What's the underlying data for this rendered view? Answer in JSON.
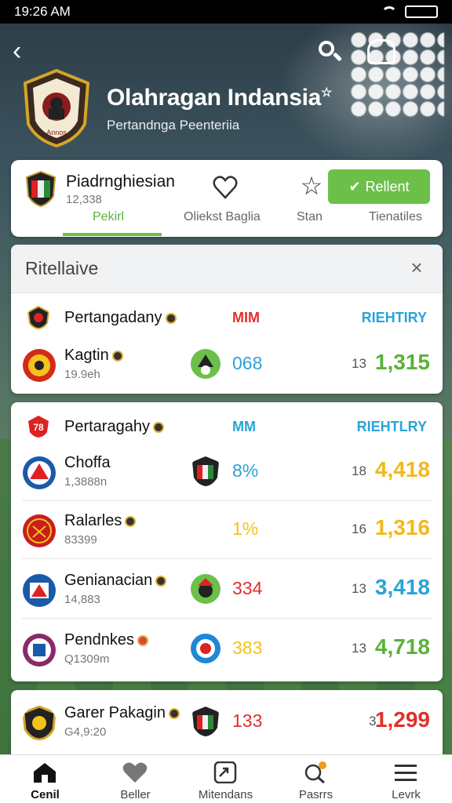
{
  "status_bar": {
    "time": "19:26 AM"
  },
  "header": {
    "title": "Olahragan Indansia",
    "subtitle": "Pertandnga Peenteriia",
    "crest_text": "Annos"
  },
  "team_card": {
    "name": "Piadrnghiesian",
    "count": "12,338",
    "follow_label": "Rellent",
    "tabs": [
      {
        "label": "Pekirl",
        "active": true
      },
      {
        "label": "Oliekst Baglia",
        "active": false
      },
      {
        "label": "Stan",
        "active": false
      },
      {
        "label": "Tienatiles",
        "active": false
      }
    ]
  },
  "panel": {
    "title": "Ritellaive",
    "close_label": "×"
  },
  "sections": [
    {
      "name": "Pertangadany",
      "col_mid": "MIM",
      "col_right": "RIEHTIRY",
      "mid_color": "#e0302a",
      "right_color": "#2aa3d6",
      "rows": [
        {
          "name": "Kagtin",
          "sub": "19.9eh",
          "pct": "068",
          "pct_color": "#2aa3d6",
          "small": "13",
          "score": "1,315",
          "score_color": "#5bb13a"
        }
      ]
    },
    {
      "name": "Pertaragahy",
      "icon_label": "78",
      "col_mid": "MM",
      "col_right": "RIEHTLRY",
      "mid_color": "#2aa3d6",
      "right_color": "#2aa3d6",
      "rows": [
        {
          "name": "Choffa",
          "sub": "1,3888n",
          "pct": "8%",
          "pct_color": "#2aa3d6",
          "small": "18",
          "score": "4,418",
          "score_color": "#f2b81c"
        },
        {
          "name": "Ralarles",
          "sub": "83399",
          "pct": "1%",
          "pct_color": "#f2c21c",
          "small": "16",
          "score": "1,316",
          "score_color": "#f2b81c"
        },
        {
          "name": "Genianacian",
          "sub": "14,883",
          "pct": "334",
          "pct_color": "#e0302a",
          "small": "13",
          "score": "3,418",
          "score_color": "#2aa3d6"
        },
        {
          "name": "Pendnkes",
          "sub": "Q1309m",
          "pct": "383",
          "pct_color": "#f2c21c",
          "small": "13",
          "score": "4,718",
          "score_color": "#5bb13a"
        }
      ]
    },
    {
      "name": "Garer Pakagin",
      "sub": "G4,9:20",
      "pct": "133",
      "pct_color": "#e0302a",
      "small": "3",
      "score": "1,299",
      "score_color": "#e0302a"
    }
  ],
  "bottom_nav": [
    {
      "label": "Cenil",
      "icon": "home-icon",
      "active": true
    },
    {
      "label": "Beller",
      "icon": "heart-icon",
      "active": false
    },
    {
      "label": "Mitendans",
      "icon": "chart-icon",
      "active": false
    },
    {
      "label": "Pasrrs",
      "icon": "search-badge-icon",
      "active": false
    },
    {
      "label": "Levrk",
      "icon": "menu-icon",
      "active": false
    }
  ]
}
